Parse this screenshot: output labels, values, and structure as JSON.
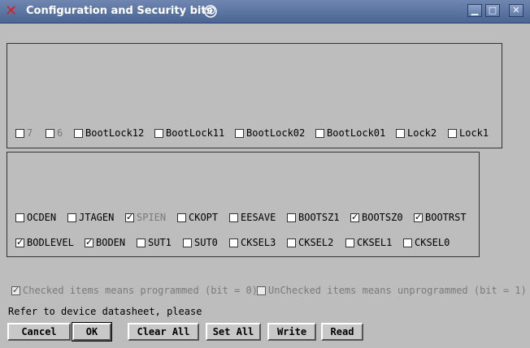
{
  "window": {
    "title": "Configuration and Security bits",
    "min_label": "▁",
    "max_label": "□",
    "close_label": "✕"
  },
  "lock_bits": [
    {
      "label": "7",
      "checked": false,
      "enabled": false
    },
    {
      "label": "6",
      "checked": false,
      "enabled": false
    },
    {
      "label": "BootLock12",
      "checked": false,
      "enabled": true
    },
    {
      "label": "BootLock11",
      "checked": false,
      "enabled": true
    },
    {
      "label": "BootLock02",
      "checked": false,
      "enabled": true
    },
    {
      "label": "BootLock01",
      "checked": false,
      "enabled": true
    },
    {
      "label": "Lock2",
      "checked": false,
      "enabled": true
    },
    {
      "label": "Lock1",
      "checked": false,
      "enabled": true
    }
  ],
  "fuse_row1": [
    {
      "label": "OCDEN",
      "checked": false,
      "enabled": true
    },
    {
      "label": "JTAGEN",
      "checked": false,
      "enabled": true
    },
    {
      "label": "SPIEN",
      "checked": true,
      "enabled": false
    },
    {
      "label": "CKOPT",
      "checked": false,
      "enabled": true
    },
    {
      "label": "EESAVE",
      "checked": false,
      "enabled": true
    },
    {
      "label": "BOOTSZ1",
      "checked": false,
      "enabled": true
    },
    {
      "label": "BOOTSZ0",
      "checked": true,
      "enabled": true
    },
    {
      "label": "BOOTRST",
      "checked": true,
      "enabled": true
    }
  ],
  "fuse_row2": [
    {
      "label": "BODLEVEL",
      "checked": true,
      "enabled": true
    },
    {
      "label": "BODEN",
      "checked": true,
      "enabled": true
    },
    {
      "label": "SUT1",
      "checked": false,
      "enabled": true
    },
    {
      "label": "SUT0",
      "checked": false,
      "enabled": true
    },
    {
      "label": "CKSEL3",
      "checked": false,
      "enabled": true
    },
    {
      "label": "CKSEL2",
      "checked": false,
      "enabled": true
    },
    {
      "label": "CKSEL1",
      "checked": false,
      "enabled": true
    },
    {
      "label": "CKSEL0",
      "checked": false,
      "enabled": true
    }
  ],
  "legend": {
    "checked_text": "Checked items means programmed (bit = 0)",
    "unchecked_text": "UnChecked items means unprogrammed (bit = 1)"
  },
  "refer_text": "Refer to device datasheet, please",
  "buttons": {
    "cancel": "Cancel",
    "ok": "OK",
    "clear_all": "Clear All",
    "set_all": "Set All",
    "write": "Write",
    "read": "Read"
  }
}
